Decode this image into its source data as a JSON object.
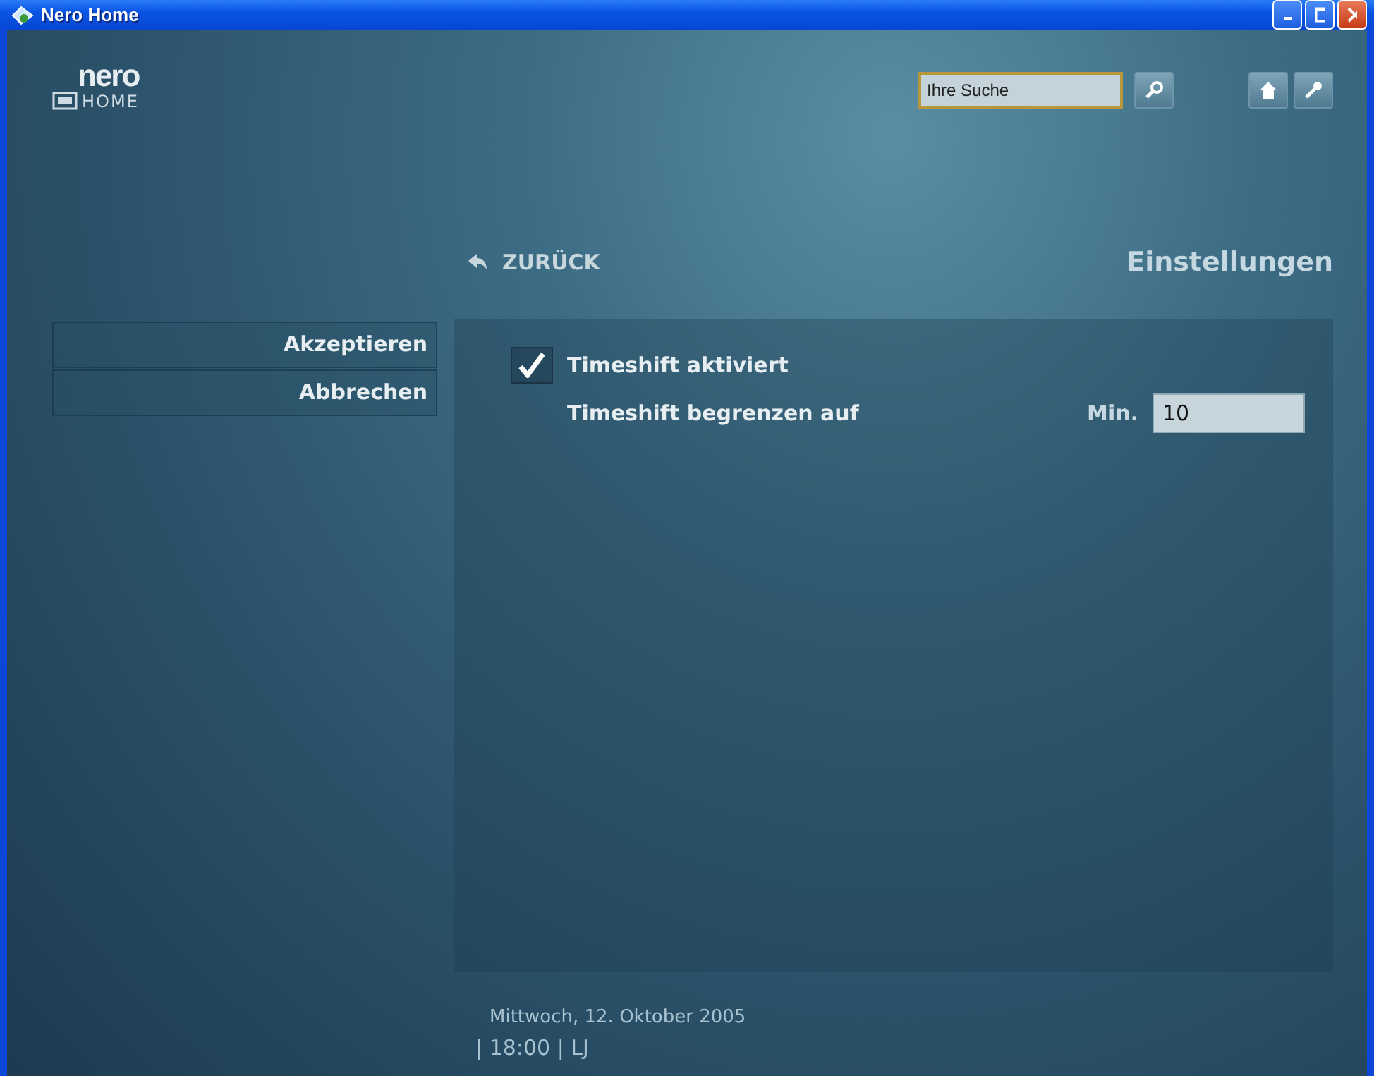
{
  "window": {
    "title": "Nero Home"
  },
  "logo": {
    "top": "nero",
    "bottom": "HOME"
  },
  "search": {
    "placeholder": "Ihre Suche"
  },
  "back": {
    "label": "ZURÜCK"
  },
  "page_title": "Einstellungen",
  "actions": [
    {
      "label": "Akzeptieren"
    },
    {
      "label": "Abbrechen"
    }
  ],
  "settings": [
    {
      "kind": "checkbox",
      "label": "Timeshift aktiviert",
      "checked": true
    },
    {
      "kind": "number",
      "label": "Timeshift begrenzen auf",
      "unit": "Min.",
      "value": "10"
    }
  ],
  "footer": {
    "date": "Mittwoch, 12. Oktober 2005",
    "time": "| 18:00 | LJ"
  }
}
